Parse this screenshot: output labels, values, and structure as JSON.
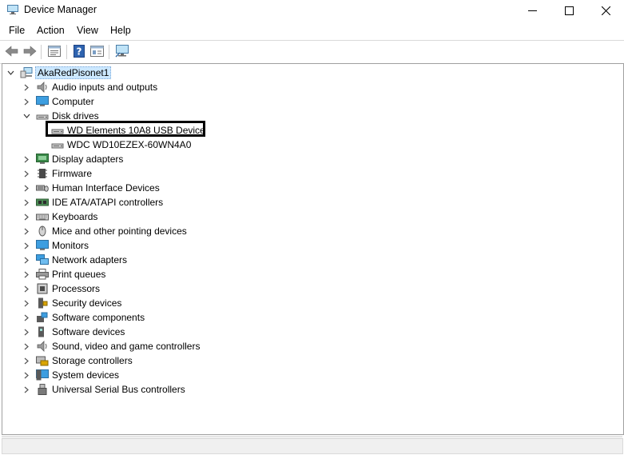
{
  "window": {
    "title": "Device Manager",
    "icon": "device-manager-icon"
  },
  "menu": [
    "File",
    "Action",
    "View",
    "Help"
  ],
  "toolbar": {
    "buttons": [
      "back-arrow-icon",
      "forward-arrow-icon",
      "properties-icon",
      "help-icon",
      "show-hidden-icon",
      "monitor-scan-icon"
    ]
  },
  "tree": {
    "root": "AkaRedPisonet1",
    "categories": [
      {
        "label": "Audio inputs and outputs",
        "icon": "speaker-icon",
        "expanded": false
      },
      {
        "label": "Computer",
        "icon": "computer-icon",
        "expanded": false
      },
      {
        "label": "Disk drives",
        "icon": "disk-drive-icon",
        "expanded": true,
        "children": [
          "WD Elements 10A8 USB Device",
          "WDC WD10EZEX-60WN4A0"
        ]
      },
      {
        "label": "Display adapters",
        "icon": "display-adapter-icon",
        "expanded": false
      },
      {
        "label": "Firmware",
        "icon": "firmware-icon",
        "expanded": false
      },
      {
        "label": "Human Interface Devices",
        "icon": "hid-icon",
        "expanded": false
      },
      {
        "label": "IDE ATA/ATAPI controllers",
        "icon": "ide-controller-icon",
        "expanded": false
      },
      {
        "label": "Keyboards",
        "icon": "keyboard-icon",
        "expanded": false
      },
      {
        "label": "Mice and other pointing devices",
        "icon": "mouse-icon",
        "expanded": false
      },
      {
        "label": "Monitors",
        "icon": "monitor-icon",
        "expanded": false
      },
      {
        "label": "Network adapters",
        "icon": "network-adapter-icon",
        "expanded": false
      },
      {
        "label": "Print queues",
        "icon": "printer-icon",
        "expanded": false
      },
      {
        "label": "Processors",
        "icon": "processor-icon",
        "expanded": false
      },
      {
        "label": "Security devices",
        "icon": "security-device-icon",
        "expanded": false
      },
      {
        "label": "Software components",
        "icon": "software-component-icon",
        "expanded": false
      },
      {
        "label": "Software devices",
        "icon": "software-device-icon",
        "expanded": false
      },
      {
        "label": "Sound, video and game controllers",
        "icon": "sound-icon",
        "expanded": false
      },
      {
        "label": "Storage controllers",
        "icon": "storage-controller-icon",
        "expanded": false
      },
      {
        "label": "System devices",
        "icon": "system-device-icon",
        "expanded": false
      },
      {
        "label": "Universal Serial Bus controllers",
        "icon": "usb-icon",
        "expanded": false
      }
    ]
  },
  "highlighted_device": "WD Elements 10A8 USB Device",
  "colors": {
    "selection": "#cce8ff",
    "highlight_border": "#000000"
  }
}
